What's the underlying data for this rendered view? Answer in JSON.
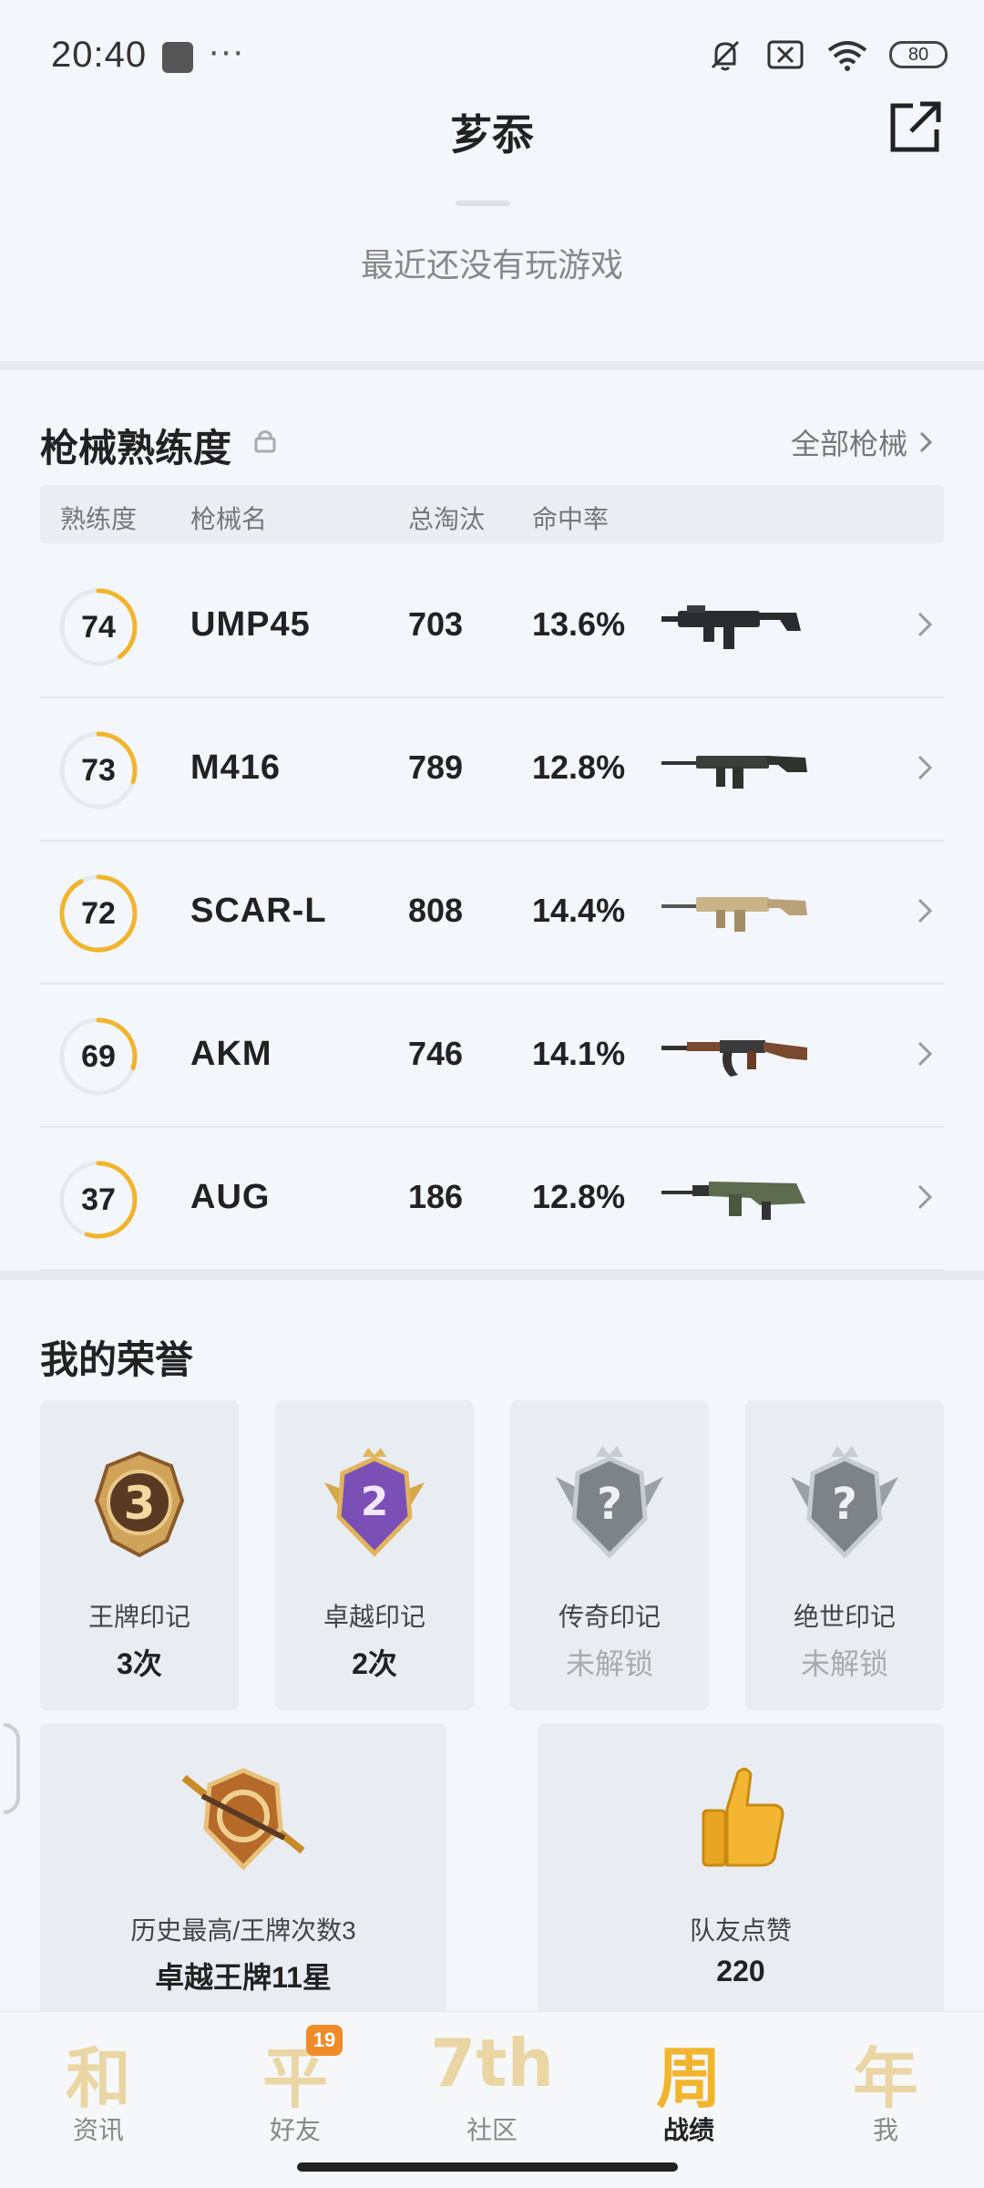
{
  "status": {
    "time": "20:40",
    "dots": "···",
    "battery": "80"
  },
  "header": {
    "title": "芗忝"
  },
  "recent": {
    "empty_text": "最近还没有玩游戏"
  },
  "weapons": {
    "title": "枪械熟练度",
    "all_link": "全部枪械",
    "columns": [
      "熟练度",
      "枪械名",
      "总淘汰",
      "命中率"
    ],
    "rows": [
      {
        "level": "74",
        "name": "UMP45",
        "kills": "703",
        "rate": "13.6%",
        "progress": 0.4
      },
      {
        "level": "73",
        "name": "M416",
        "kills": "789",
        "rate": "12.8%",
        "progress": 0.3
      },
      {
        "level": "72",
        "name": "SCAR-L",
        "kills": "808",
        "rate": "14.4%",
        "progress": 0.92
      },
      {
        "level": "69",
        "name": "AKM",
        "kills": "746",
        "rate": "14.1%",
        "progress": 0.3
      },
      {
        "level": "37",
        "name": "AUG",
        "kills": "186",
        "rate": "12.8%",
        "progress": 0.55
      }
    ]
  },
  "honors": {
    "title": "我的荣誉",
    "cards": [
      {
        "name": "王牌印记",
        "value": "3次",
        "badge_text": "3",
        "locked": false
      },
      {
        "name": "卓越印记",
        "value": "2次",
        "badge_text": "2",
        "locked": false
      },
      {
        "name": "传奇印记",
        "value": "未解锁",
        "badge_text": "?",
        "locked": true
      },
      {
        "name": "绝世印记",
        "value": "未解锁",
        "badge_text": "?",
        "locked": true
      }
    ],
    "best": {
      "label": "历史最高/王牌次数3",
      "value": "卓越王牌11星"
    },
    "likes": {
      "label": "队友点赞",
      "value": "220"
    }
  },
  "nav": {
    "items": [
      {
        "glyph": "和",
        "label": "资讯"
      },
      {
        "glyph": "平",
        "label": "好友",
        "badge": "19"
      },
      {
        "glyph": "7th",
        "label": "社区"
      },
      {
        "glyph": "周",
        "label": "战绩"
      },
      {
        "glyph": "年",
        "label": "我"
      }
    ]
  },
  "colors": {
    "accent": "#f1b52d",
    "ring_track": "#e6e9ee"
  }
}
